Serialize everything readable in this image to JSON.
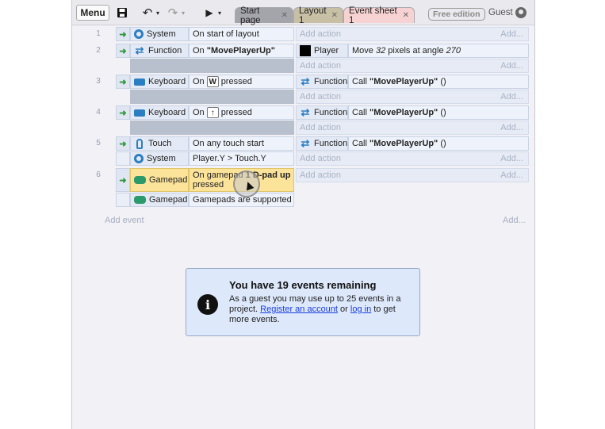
{
  "toolbar": {
    "menu_label": "Menu",
    "tabs": [
      {
        "label": "Start page"
      },
      {
        "label": "Layout 1"
      },
      {
        "label": "Event sheet 1"
      }
    ],
    "free_edition": "Free edition",
    "user": "Guest"
  },
  "events": [
    {
      "number": "1",
      "conditions": [
        {
          "object": "System",
          "icon": "gear-icon",
          "text": "On start of layout"
        }
      ],
      "actions": [],
      "add_action": "Add action",
      "add_short": "Add..."
    },
    {
      "number": "2",
      "conditions": [
        {
          "object": "Function",
          "icon": "function-icon",
          "text_prefix": "On ",
          "text_bold": "\"MovePlayerUp\""
        }
      ],
      "actions": [
        {
          "object": "Player",
          "icon": "player-sprite",
          "text_prefix": "Move ",
          "text_italic": "32",
          "text_mid": " pixels at angle ",
          "text_italic2": "270"
        }
      ],
      "add_action": "Add action",
      "add_short": "Add..."
    },
    {
      "number": "3",
      "conditions": [
        {
          "object": "Keyboard",
          "icon": "keyboard-icon",
          "text_prefix": "On",
          "key": "W",
          "text_suffix": "pressed"
        }
      ],
      "actions": [
        {
          "object": "Function",
          "icon": "function-icon",
          "text_prefix": "Call ",
          "text_bold": "\"MovePlayerUp\"",
          "text_suffix": " ()"
        }
      ],
      "add_action": "Add action",
      "add_short": "Add..."
    },
    {
      "number": "4",
      "conditions": [
        {
          "object": "Keyboard",
          "icon": "keyboard-icon",
          "text_prefix": "On",
          "key": "↑",
          "text_suffix": "pressed"
        }
      ],
      "actions": [
        {
          "object": "Function",
          "icon": "function-icon",
          "text_prefix": "Call ",
          "text_bold": "\"MovePlayerUp\"",
          "text_suffix": " ()"
        }
      ],
      "add_action": "Add action",
      "add_short": "Add..."
    },
    {
      "number": "5",
      "conditions": [
        {
          "object": "Touch",
          "icon": "touch-icon",
          "text": "On any touch start"
        },
        {
          "object": "System",
          "icon": "gear-icon",
          "text": "Player.Y > Touch.Y"
        }
      ],
      "actions": [
        {
          "object": "Function",
          "icon": "function-icon",
          "text_prefix": "Call ",
          "text_bold": "\"MovePlayerUp\"",
          "text_suffix": " ()"
        }
      ],
      "add_action": "Add action",
      "add_short": "Add..."
    },
    {
      "number": "6",
      "conditions": [
        {
          "object": "Gamepad",
          "icon": "gamepad-icon",
          "text_prefix": "On gamepad ",
          "text_bold": "1 D-pad up",
          "text_suffix": "pressed"
        },
        {
          "object": "Gamepad",
          "icon": "gamepad-icon",
          "text": "Gamepads are supported"
        }
      ],
      "actions": [],
      "add_action": "Add action",
      "add_short": "Add..."
    }
  ],
  "add_event": "Add event",
  "add_event_short": "Add...",
  "notice": {
    "title": "You have 19 events remaining",
    "body_prefix": "As a guest you may use up to 25 events in a project. ",
    "register_link": "Register an account",
    "or": " or ",
    "login_link": "log in",
    "body_suffix": " to get more events."
  },
  "colors": {
    "highlight": "#fbe39a",
    "accent": "#2c7ec2",
    "tab_active": "#f7d2d2"
  }
}
